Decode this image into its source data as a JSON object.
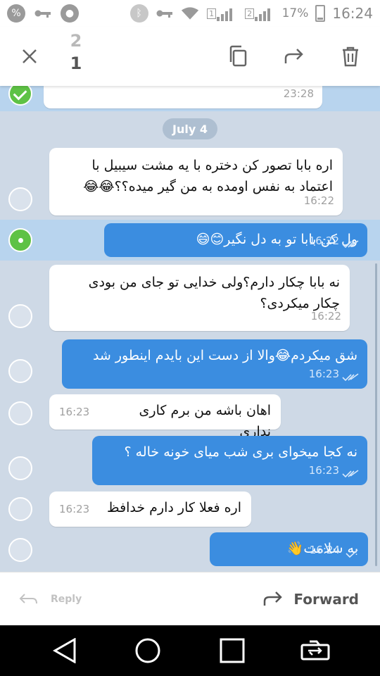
{
  "status_bar": {
    "sim1": "1",
    "sim2": "2",
    "battery": "17%",
    "time": "16:24"
  },
  "action_bar": {
    "count_prev": "2",
    "count_current": "1"
  },
  "chat": {
    "top_partial_time": "23:28",
    "date_label": "July 4",
    "messages": [
      {
        "direction": "in",
        "lines": [
          "اره بابا تصور کن دختره با یه مشت سیبیل با",
          "اعتماد به نفس اومده به من گیر میده؟؟😂😂"
        ],
        "time": "16:22",
        "selected": false
      },
      {
        "direction": "out",
        "text": "ول کن بابا تو به دل نگیر😊😄",
        "time": "16:22",
        "selected": true
      },
      {
        "direction": "in",
        "lines": [
          "نه بابا چکار دارم؟ولی خدایی تو جای من بودی",
          "چکار میکردی؟"
        ],
        "time": "16:22",
        "selected": false
      },
      {
        "direction": "out",
        "text": "شق میکردم😂والا از دست این بایدم اینطور شد",
        "time": "16:23",
        "selected": false
      },
      {
        "direction": "in",
        "text": "اهان باشه من برم کاری نداری",
        "time": "16:23",
        "selected": false
      },
      {
        "direction": "out",
        "text": "نه کجا میخوای بری شب میای خونه خاله ؟",
        "time": "16:23",
        "selected": false
      },
      {
        "direction": "in",
        "text": "اره فعلا کار دارم خدافظ",
        "time": "16:23",
        "selected": false
      },
      {
        "direction": "out",
        "text": "به سلامت👋",
        "time": "16:24",
        "selected": false
      }
    ]
  },
  "bottom_bar": {
    "reply_label": "Reply",
    "forward_label": "Forward"
  },
  "colors": {
    "chat_bg": "#ced9e6",
    "selected_row": "#b8d4ee",
    "outgoing_bubble": "#3b8de0",
    "incoming_bubble": "#ffffff",
    "check_on": "#5ec245"
  }
}
